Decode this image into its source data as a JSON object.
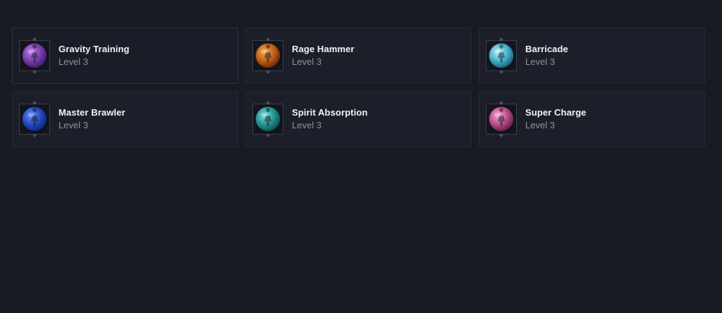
{
  "abilities": [
    {
      "name": "Gravity Training",
      "level": "Level 3",
      "icon": "gravity-training-icon",
      "colors": [
        "#c77fe6",
        "#6d3aa8",
        "#2a1446"
      ],
      "selected": true
    },
    {
      "name": "Rage Hammer",
      "level": "Level 3",
      "icon": "rage-hammer-icon",
      "colors": [
        "#f2b050",
        "#b75a17",
        "#3d1808"
      ],
      "selected": false
    },
    {
      "name": "Barricade",
      "level": "Level 3",
      "icon": "barricade-icon",
      "colors": [
        "#b9f1f8",
        "#3fa9c6",
        "#11405a"
      ],
      "selected": false
    },
    {
      "name": "Master Brawler",
      "level": "Level 3",
      "icon": "master-brawler-icon",
      "colors": [
        "#6a8dff",
        "#2146b8",
        "#0b1650"
      ],
      "selected": false
    },
    {
      "name": "Spirit Absorption",
      "level": "Level 3",
      "icon": "spirit-absorption-icon",
      "colors": [
        "#7be0df",
        "#1f8b8c",
        "#0a3436"
      ],
      "selected": false
    },
    {
      "name": "Super Charge",
      "level": "Level 3",
      "icon": "super-charge-icon",
      "colors": [
        "#f5a9d6",
        "#b0467f",
        "#3c1230"
      ],
      "selected": false
    }
  ]
}
